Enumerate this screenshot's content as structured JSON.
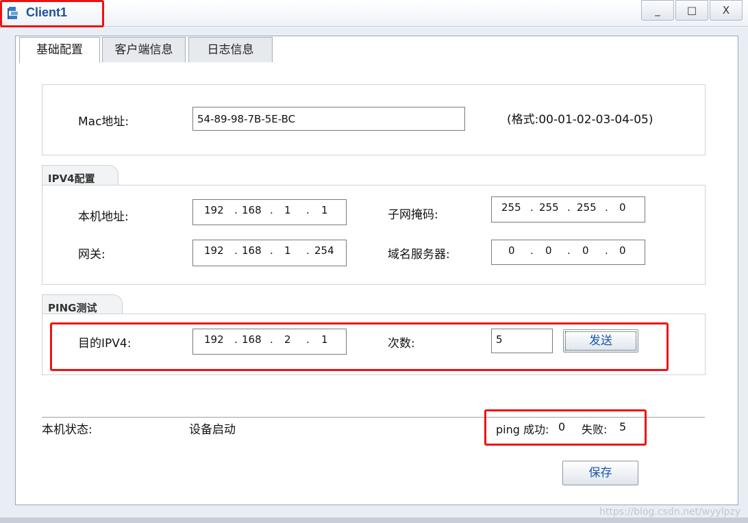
{
  "window": {
    "title": "Client1",
    "minimize": "_",
    "maximize": "□",
    "close": "X"
  },
  "tabs": [
    "基础配置",
    "客户端信息",
    "日志信息"
  ],
  "mac": {
    "label": "Mac地址:",
    "value": "54-89-98-7B-5E-BC",
    "hint": "(格式:00-01-02-03-04-05)"
  },
  "ipv4": {
    "section": "IPV4配置",
    "local_label": "本机地址:",
    "local": [
      "192",
      "168",
      "1",
      "1"
    ],
    "mask_label": "子网掩码:",
    "mask": [
      "255",
      "255",
      "255",
      "0"
    ],
    "gateway_label": "网关:",
    "gateway": [
      "192",
      "168",
      "1",
      "254"
    ],
    "dns_label": "域名服务器:",
    "dns": [
      "0",
      "0",
      "0",
      "0"
    ]
  },
  "ping": {
    "section": "PING测试",
    "target_label": "目的IPV4:",
    "target": [
      "192",
      "168",
      "2",
      "1"
    ],
    "count_label": "次数:",
    "count": "5",
    "send_button": "发送"
  },
  "status": {
    "label": "本机状态:",
    "value": "设备启动",
    "ping_success_label": "ping 成功:",
    "ping_success": "0",
    "ping_fail_label": "失败:",
    "ping_fail": "5"
  },
  "save_button": "保存",
  "watermark": "https://blog.csdn.net/wyylpzy",
  "colors": {
    "highlight": "#ee1111",
    "title": "#1c4f9c",
    "button_text": "#1b56a8"
  },
  "icons": {
    "app": "network-client-icon"
  }
}
